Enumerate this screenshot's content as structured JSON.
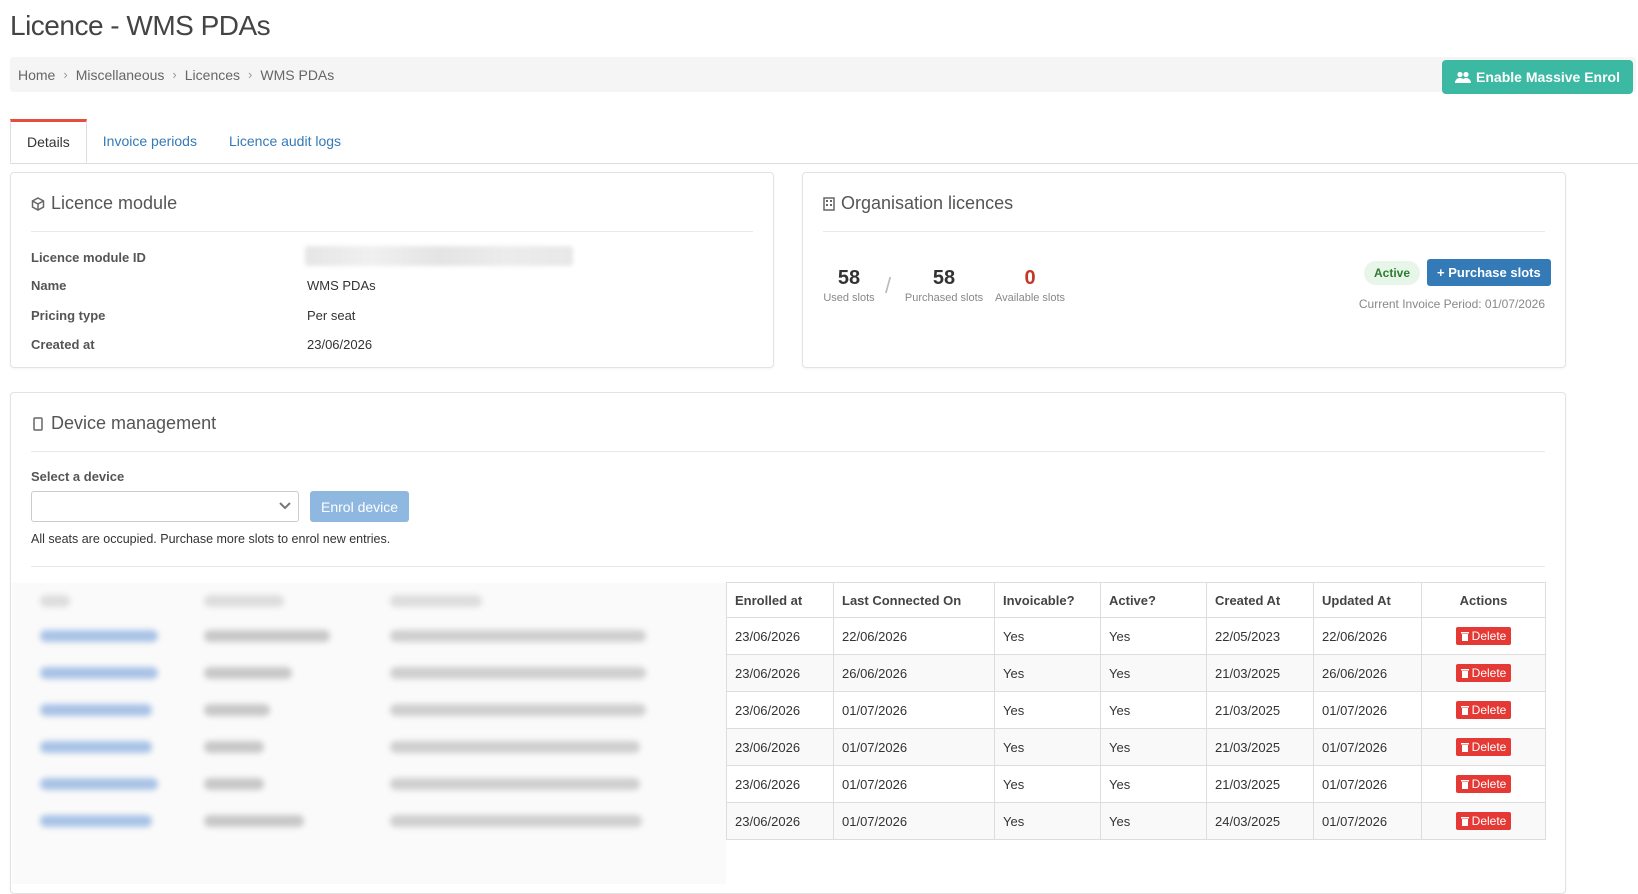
{
  "page": {
    "title": "Licence - WMS PDAs"
  },
  "breadcrumb": [
    "Home",
    "Miscellaneous",
    "Licences",
    "WMS PDAs"
  ],
  "header": {
    "massive_enrol_label": "Enable Massive Enrol",
    "massive_enrol_icon": "users-icon"
  },
  "tabs": [
    "Details",
    "Invoice periods",
    "Licence audit logs"
  ],
  "licence_module": {
    "title": "Licence module",
    "icon": "cube-icon",
    "fields": [
      {
        "label": "Licence module ID",
        "value": ""
      },
      {
        "label": "Name",
        "value": "WMS PDAs"
      },
      {
        "label": "Pricing type",
        "value": "Per seat"
      },
      {
        "label": "Created at",
        "value": "23/06/2026"
      }
    ]
  },
  "organisation": {
    "title": "Organisation licences",
    "icon": "building-icon",
    "used": {
      "value": "58",
      "label": "Used slots"
    },
    "purchased": {
      "value": "58",
      "label": "Purchased slots"
    },
    "available": {
      "value": "0",
      "label": "Available slots"
    },
    "status": "Active",
    "purchase_label": "Purchase slots",
    "invoice_period": "Current Invoice Period: 01/07/2026"
  },
  "device_management": {
    "title": "Device management",
    "icon": "tablet-icon",
    "select_label": "Select a device",
    "select_value": "",
    "enrol_label": "Enrol device",
    "notice": "All seats are occupied. Purchase more slots to enrol new entries."
  },
  "table": {
    "columns": [
      "Enrolled at",
      "Last Connected On",
      "Invoicable?",
      "Active?",
      "Created At",
      "Updated At",
      "Actions"
    ],
    "delete_label": "Delete",
    "rows": [
      [
        "23/06/2026",
        "22/06/2026",
        "Yes",
        "Yes",
        "22/05/2023",
        "22/06/2026"
      ],
      [
        "23/06/2026",
        "26/06/2026",
        "Yes",
        "Yes",
        "21/03/2025",
        "26/06/2026"
      ],
      [
        "23/06/2026",
        "01/07/2026",
        "Yes",
        "Yes",
        "21/03/2025",
        "01/07/2026"
      ],
      [
        "23/06/2026",
        "01/07/2026",
        "Yes",
        "Yes",
        "21/03/2025",
        "01/07/2026"
      ],
      [
        "23/06/2026",
        "01/07/2026",
        "Yes",
        "Yes",
        "21/03/2025",
        "01/07/2026"
      ],
      [
        "23/06/2026",
        "01/07/2026",
        "Yes",
        "Yes",
        "24/03/2025",
        "01/07/2026"
      ]
    ]
  },
  "colors": {
    "accent": "#3cb9a3",
    "primary": "#337ab7",
    "danger": "#e53935",
    "tab_active": "#e74c3c"
  }
}
